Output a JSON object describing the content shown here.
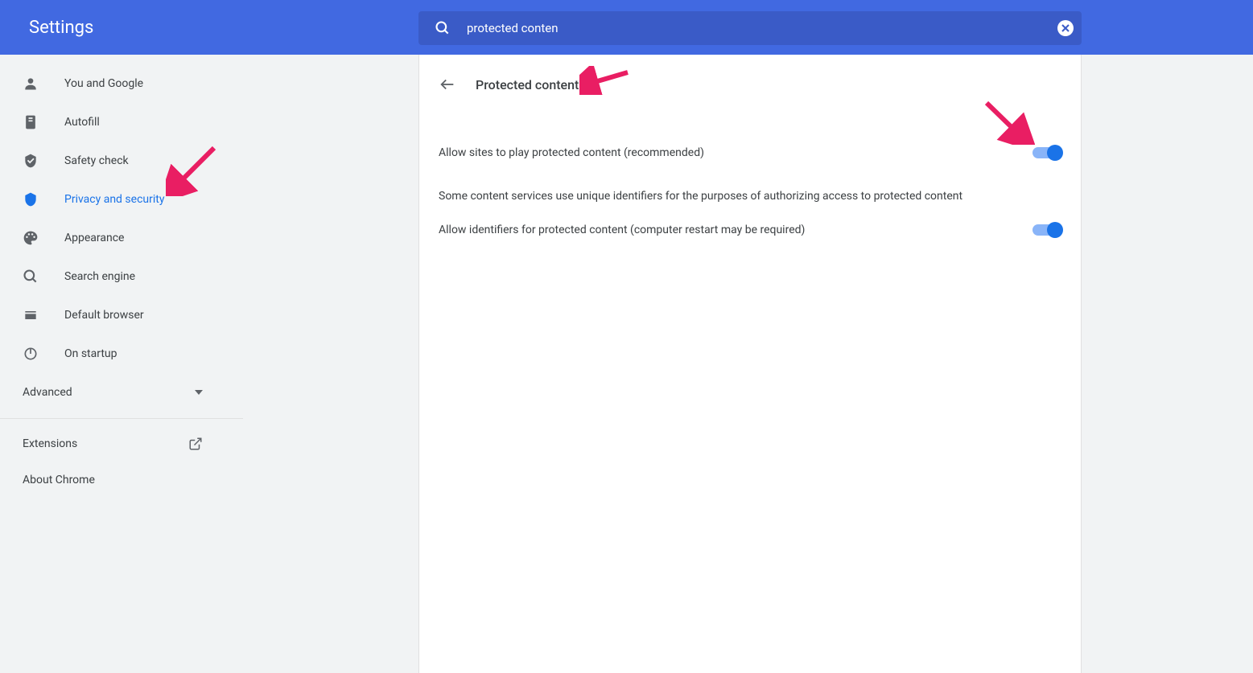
{
  "header": {
    "title": "Settings"
  },
  "search": {
    "value": "protected conten"
  },
  "sidebar": {
    "items": [
      {
        "label": "You and Google",
        "icon": "person"
      },
      {
        "label": "Autofill",
        "icon": "autofill"
      },
      {
        "label": "Safety check",
        "icon": "safety"
      },
      {
        "label": "Privacy and security",
        "icon": "shield",
        "active": true
      },
      {
        "label": "Appearance",
        "icon": "palette"
      },
      {
        "label": "Search engine",
        "icon": "search"
      },
      {
        "label": "Default browser",
        "icon": "browser"
      },
      {
        "label": "On startup",
        "icon": "power"
      }
    ],
    "advanced": "Advanced",
    "extensions": "Extensions",
    "about": "About Chrome"
  },
  "panel": {
    "title": "Protected content",
    "setting1": "Allow sites to play protected content (recommended)",
    "info": "Some content services use unique identifiers for the purposes of authorizing access to protected content",
    "setting2": "Allow identifiers for protected content (computer restart may be required)"
  }
}
